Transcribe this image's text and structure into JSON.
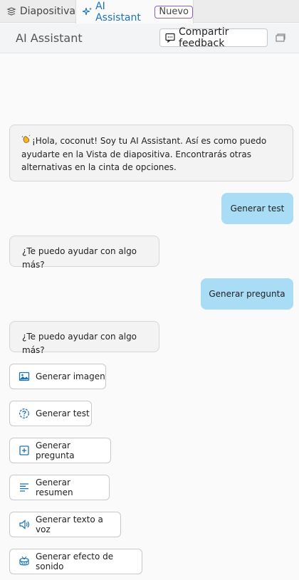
{
  "tabs": {
    "diapositiva": "Diapositiva",
    "ai_assistant": "AI Assistant",
    "badge": "Nuevo"
  },
  "header": {
    "title": "AI Assistant",
    "feedback_label": "Compartir feedback"
  },
  "chat": {
    "greeting": "¡Hola, coconut! Soy tu AI Assistant. Así es como puedo ayudarte en la Vista de diapositiva. Encontrarás otras alternativas en la cinta de opciones.",
    "user_msg_1": "Generar test",
    "bot_msg_1": "¿Te puedo ayudar con algo más?",
    "user_msg_2": "Generar pregunta",
    "bot_msg_2": "¿Te puedo ayudar con algo más?"
  },
  "actions": [
    {
      "label": "Generar imagen",
      "icon": "image-icon"
    },
    {
      "label": "Generar test",
      "icon": "quiz-icon"
    },
    {
      "label": "Generar pregunta",
      "icon": "add-question-icon"
    },
    {
      "label": "Generar resumen",
      "icon": "summary-icon"
    },
    {
      "label": "Generar texto a voz",
      "icon": "speaker-icon"
    },
    {
      "label": "Generar efecto de sonido",
      "icon": "drum-icon"
    }
  ],
  "colors": {
    "accent": "#1a73b8",
    "user_bubble": "#a9dcf5",
    "badge_border": "#8c5cc9"
  }
}
